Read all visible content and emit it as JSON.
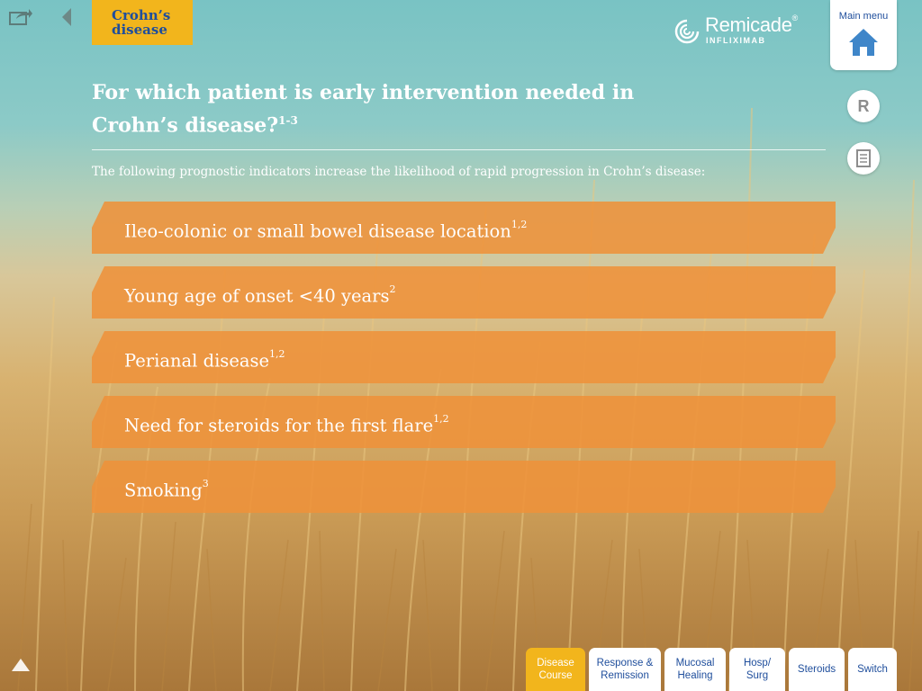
{
  "header": {
    "section_tag": "Crohn’s disease",
    "logo_word": "Remicade",
    "logo_reg": "®",
    "logo_sub": "INFLIXIMAB",
    "main_menu_label": "Main menu",
    "side_button_r": "R"
  },
  "main": {
    "title": "For which patient is early intervention needed in Crohn’s disease?",
    "title_ref": "1-3",
    "intro": "The following prognostic indicators increase the likelihood of rapid progression in Crohn’s disease:",
    "items": [
      {
        "text": "Ileo-colonic or small bowel disease location",
        "ref": "1,2"
      },
      {
        "text": "Young age of onset <40 years",
        "ref": "2"
      },
      {
        "text": "Perianal disease",
        "ref": "1,2"
      },
      {
        "text": "Need for steroids for the first flare",
        "ref": "1,2"
      },
      {
        "text": "Smoking",
        "ref": "3"
      }
    ]
  },
  "tabs": [
    {
      "label": "Disease Course",
      "active": true
    },
    {
      "label": "Response & Remission",
      "active": false
    },
    {
      "label": "Mucosal Healing",
      "active": false
    },
    {
      "label": "Hosp/ Surg",
      "active": false
    },
    {
      "label": "Steroids",
      "active": false
    },
    {
      "label": "Switch",
      "active": false
    }
  ],
  "colors": {
    "accent_yellow": "#f2b51c",
    "item_orange": "#ee923a",
    "brand_blue": "#1f4e9c",
    "icon_blue": "#3f86c9"
  },
  "icons": [
    "share-icon",
    "back-arrow-icon",
    "remicade-logo-icon",
    "home-icon",
    "reference-icon",
    "document-icon",
    "scroll-up-icon"
  ]
}
